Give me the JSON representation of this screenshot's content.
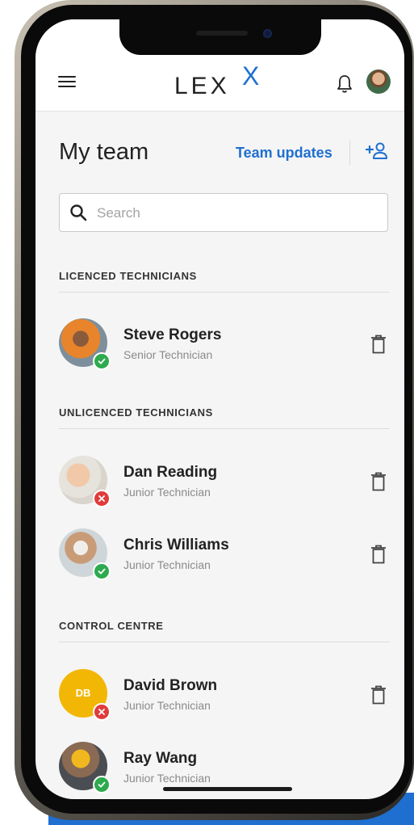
{
  "header": {
    "logo_text": "LEX",
    "logo_accent": "X",
    "menu_icon": "hamburger-menu-icon",
    "notification_icon": "bell-icon"
  },
  "page": {
    "title": "My team",
    "team_updates_label": "Team updates",
    "add_member_icon": "add-user-icon"
  },
  "search": {
    "placeholder": "Search",
    "value": ""
  },
  "sections": [
    {
      "label": "LICENCED TECHNICIANS",
      "members": [
        {
          "name": "Steve Rogers",
          "role": "Senior Technician",
          "status": "active"
        }
      ]
    },
    {
      "label": "UNLICENCED TECHNICIANS",
      "members": [
        {
          "name": "Dan Reading",
          "role": "Junior Technician",
          "status": "inactive"
        },
        {
          "name": "Chris Williams",
          "role": "Junior Technician",
          "status": "active"
        }
      ]
    },
    {
      "label": "CONTROL CENTRE",
      "members": [
        {
          "name": "David Brown",
          "initials": "DB",
          "role": "Junior Technician",
          "status": "inactive"
        },
        {
          "name": "Ray Wang",
          "role": "Junior Technician",
          "status": "active"
        }
      ]
    }
  ],
  "colors": {
    "accent": "#1f6fd0",
    "status_active": "#2eaa4e",
    "status_inactive": "#e03c3c",
    "initials_avatar": "#f2b705"
  }
}
